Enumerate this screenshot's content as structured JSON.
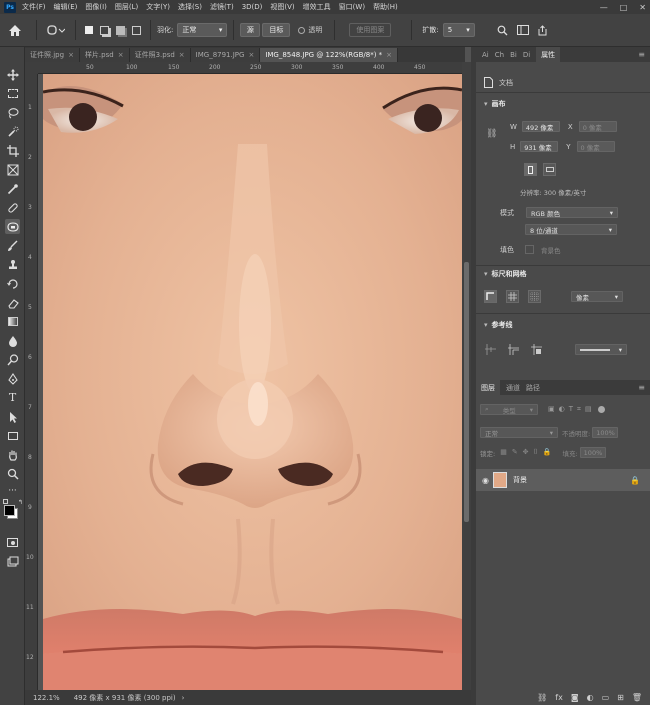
{
  "app": {
    "logo": "Ps"
  },
  "menu": [
    "文件(F)",
    "编辑(E)",
    "图像(I)",
    "图层(L)",
    "文字(Y)",
    "选择(S)",
    "滤镜(T)",
    "3D(D)",
    "视图(V)",
    "增效工具",
    "窗口(W)",
    "帮助(H)"
  ],
  "window_controls": {
    "minimize": "—",
    "maximize": "□",
    "close": "✕"
  },
  "options": {
    "feather_label": "羽化:",
    "style_value": "正常",
    "btn_1": "源",
    "btn_2": "目标",
    "transparent_label": "透明",
    "use_pattern": "使用图案",
    "spread_label": "扩散:",
    "spread_value": "5"
  },
  "tabs": [
    {
      "label": "证件照.jpg",
      "close": "×"
    },
    {
      "label": "样片.psd",
      "close": "×"
    },
    {
      "label": "证件照3.psd",
      "close": "×"
    },
    {
      "label": "IMG_8791.JPG",
      "close": "×"
    },
    {
      "label": "IMG_8548.JPG @ 122%(RGB/8*) *",
      "close": "×"
    }
  ],
  "ruler": {
    "h": [
      "50",
      "100",
      "150",
      "200",
      "250",
      "300",
      "350",
      "400",
      "450"
    ],
    "v": [
      "1",
      "2",
      "3",
      "4",
      "5",
      "6",
      "7",
      "8",
      "9",
      "10",
      "11",
      "12"
    ]
  },
  "status": {
    "zoom": "122.1%",
    "doc": "492 像素 x 931 像素 (300 ppi)",
    "arrow": "›"
  },
  "panel_tabs": [
    "Ai",
    "Ch",
    "Bi",
    "Di",
    "属性"
  ],
  "properties": {
    "doc_label": "文档",
    "canvas_title": "画布",
    "w_label": "W",
    "w_value": "492 像素",
    "x_label": "X",
    "x_value": "0 像素",
    "h_label": "H",
    "h_value": "931 像素",
    "y_label": "Y",
    "y_value": "0 像素",
    "resolution": "分辨率: 300 像素/英寸",
    "mode_label": "模式",
    "mode_value": "RGB 颜色",
    "depth_value": "8 位/通道",
    "fill_label": "填色",
    "fill_value": "背景色",
    "rulers_title": "标尺和网格",
    "units_value": "像素",
    "guides_title": "参考线"
  },
  "layers": {
    "tabs": [
      "图层",
      "通道",
      "路径"
    ],
    "kind": "类型",
    "blend": "正常",
    "opacity_label": "不透明度:",
    "opacity_value": "100%",
    "lock_label": "锁定:",
    "fill_label": "填充:",
    "fill_value": "100%",
    "layer_name": "背景"
  },
  "colors": {
    "canvas_bg": "#535353",
    "ui_dark": "#3a3a3a",
    "accent": "#31a8ff"
  }
}
